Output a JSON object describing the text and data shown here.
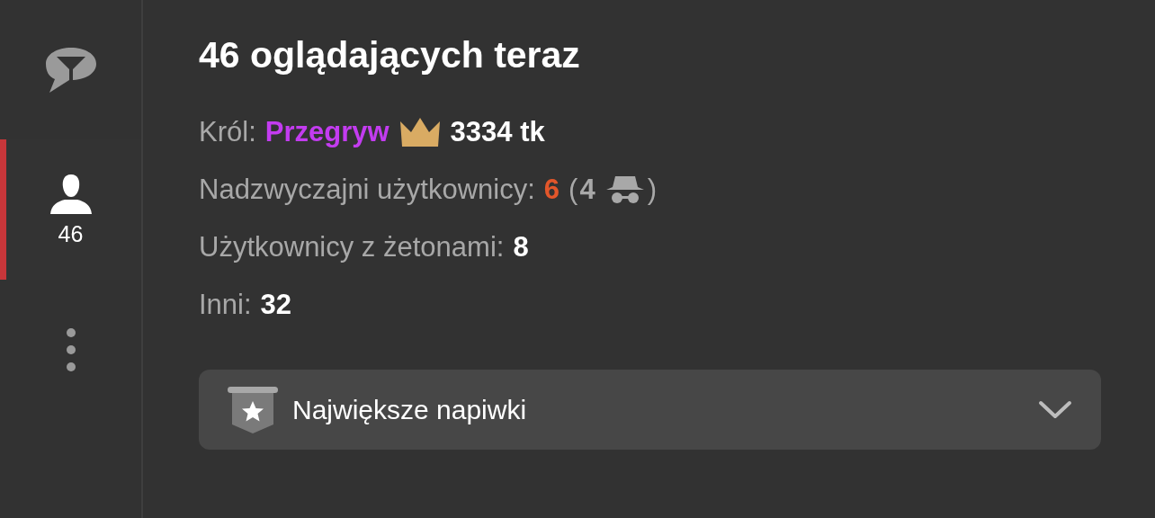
{
  "sidebar": {
    "tabs": [
      {
        "kind": "chat",
        "selected": false
      },
      {
        "kind": "users",
        "label": "46",
        "selected": true
      }
    ]
  },
  "title": "46 oglądających teraz",
  "stats": [
    {
      "kind": "king",
      "label": "Król:",
      "name": "Przegryw",
      "value": "3334 tk"
    },
    {
      "kind": "special",
      "label": "Nadzwyczajni użytkownicy:",
      "value": "6",
      "paren_open": "(",
      "hidden": "4",
      "paren_close": ")"
    },
    {
      "kind": "plain",
      "label": "Użytkownicy z żetonami:",
      "value": "8"
    },
    {
      "kind": "plain",
      "label": "Inni:",
      "value": "32"
    }
  ],
  "dropdown": {
    "label": "Największe napiwki",
    "expanded": false
  }
}
